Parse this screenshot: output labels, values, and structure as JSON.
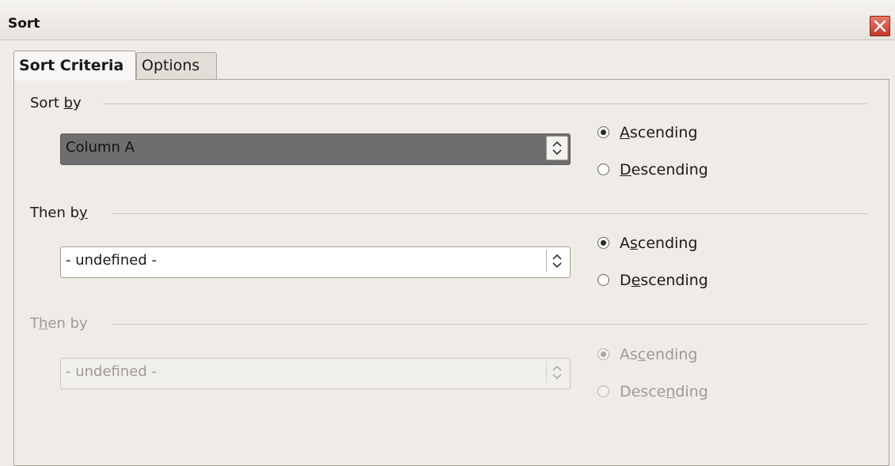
{
  "window": {
    "title": "Sort"
  },
  "tabs": [
    {
      "label": "Sort Criteria",
      "active": true
    },
    {
      "label": "Options",
      "active": false
    }
  ],
  "groups": [
    {
      "label": "Sort by",
      "combo_value": "Column A",
      "ascending": "Ascending",
      "descending": "Descending",
      "selected": "Ascending",
      "enabled": true
    },
    {
      "label": "Then by",
      "combo_value": "- undefined -",
      "ascending": "Ascending",
      "descending": "Descending",
      "selected": "Ascending",
      "enabled": true
    },
    {
      "label": "Then by",
      "combo_value": "- undefined -",
      "ascending": "Ascending",
      "descending": "Descending",
      "selected": "Ascending",
      "enabled": false
    }
  ],
  "icons": {
    "close": "close-icon",
    "spin": "chevron-up-down-icon"
  }
}
